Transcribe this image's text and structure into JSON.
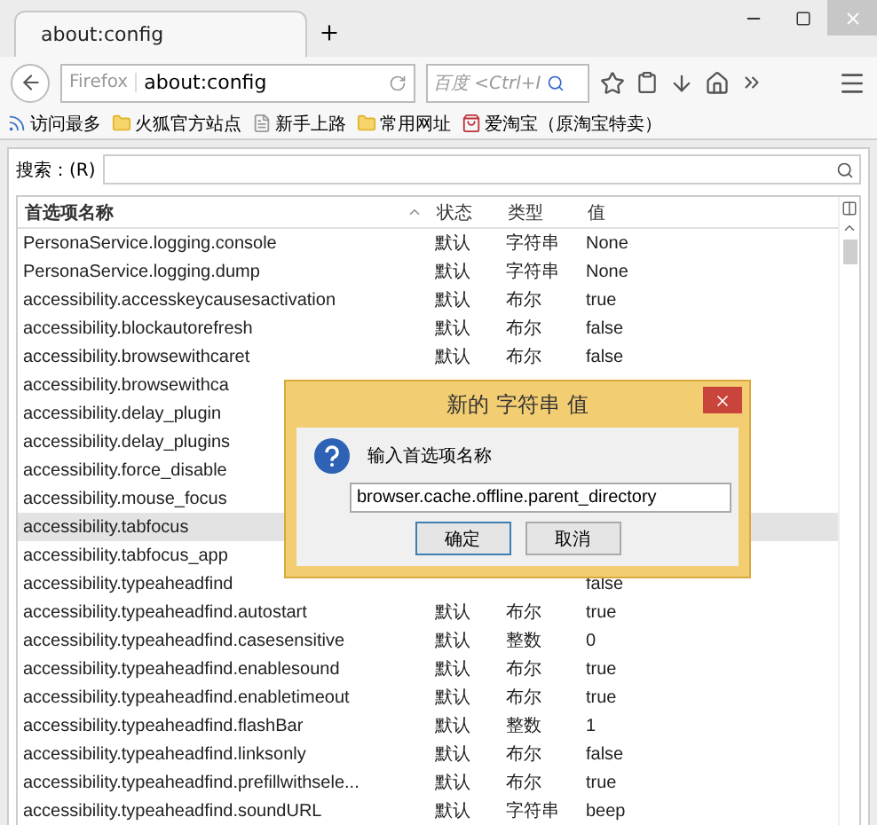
{
  "tab": {
    "title": "about:config",
    "selected": true
  },
  "toolbar": {
    "identity": "Firefox",
    "url": "about:config",
    "search_placeholder": "百度 <Ctrl+I"
  },
  "bookmarks": [
    {
      "label": "访问最多",
      "kind": "feed"
    },
    {
      "label": "火狐官方站点",
      "kind": "folder"
    },
    {
      "label": "新手上路",
      "kind": "page"
    },
    {
      "label": "常用网址",
      "kind": "folder"
    },
    {
      "label": "爱淘宝（原淘宝特卖）",
      "kind": "site"
    }
  ],
  "search": {
    "label": "搜索：(R)"
  },
  "table": {
    "columns": [
      {
        "label": "首选项名称",
        "sorted": true
      },
      {
        "label": "状态",
        "sorted": false
      },
      {
        "label": "类型",
        "sorted": false
      },
      {
        "label": "值",
        "sorted": false
      }
    ],
    "rows": [
      {
        "name": "PersonaService.logging.console",
        "status": "默认",
        "type": "字符串",
        "value": "None",
        "selected": false
      },
      {
        "name": "PersonaService.logging.dump",
        "status": "默认",
        "type": "字符串",
        "value": "None",
        "selected": false
      },
      {
        "name": "accessibility.accesskeycausesactivation",
        "status": "默认",
        "type": "布尔",
        "value": "true",
        "selected": false
      },
      {
        "name": "accessibility.blockautorefresh",
        "status": "默认",
        "type": "布尔",
        "value": "false",
        "selected": false
      },
      {
        "name": "accessibility.browsewithcaret",
        "status": "默认",
        "type": "布尔",
        "value": "false",
        "selected": false
      },
      {
        "name": "accessibility.browsewithca",
        "selected": false
      },
      {
        "name": "accessibility.delay_plugin",
        "selected": false
      },
      {
        "name": "accessibility.delay_plugins",
        "selected": false
      },
      {
        "name": "accessibility.force_disable",
        "selected": false
      },
      {
        "name": "accessibility.mouse_focus",
        "selected": false
      },
      {
        "name": "accessibility.tabfocus",
        "selected": true
      },
      {
        "name": "accessibility.tabfocus_app",
        "selected": false
      },
      {
        "name": "accessibility.typeaheadfind",
        "value": "false",
        "selected": false
      },
      {
        "name": "accessibility.typeaheadfind.autostart",
        "status": "默认",
        "type": "布尔",
        "value": "true",
        "selected": false
      },
      {
        "name": "accessibility.typeaheadfind.casesensitive",
        "status": "默认",
        "type": "整数",
        "value": "0",
        "selected": false
      },
      {
        "name": "accessibility.typeaheadfind.enablesound",
        "status": "默认",
        "type": "布尔",
        "value": "true",
        "selected": false
      },
      {
        "name": "accessibility.typeaheadfind.enabletimeout",
        "status": "默认",
        "type": "布尔",
        "value": "true",
        "selected": false
      },
      {
        "name": "accessibility.typeaheadfind.flashBar",
        "status": "默认",
        "type": "整数",
        "value": "1",
        "selected": false
      },
      {
        "name": "accessibility.typeaheadfind.linksonly",
        "status": "默认",
        "type": "布尔",
        "value": "false",
        "selected": false
      },
      {
        "name": "accessibility.typeaheadfind.prefillwithsele...",
        "status": "默认",
        "type": "布尔",
        "value": "true",
        "selected": false
      },
      {
        "name": "accessibility.typeaheadfind.soundURL",
        "status": "默认",
        "type": "字符串",
        "value": "beep",
        "selected": false
      }
    ]
  },
  "dialog": {
    "title": "新的 字符串 值",
    "prompt": "输入首选项名称",
    "value": "browser.cache.offline.parent_directory",
    "buttons": [
      {
        "label": "确定",
        "default": true
      },
      {
        "label": "取消",
        "default": false
      }
    ]
  }
}
